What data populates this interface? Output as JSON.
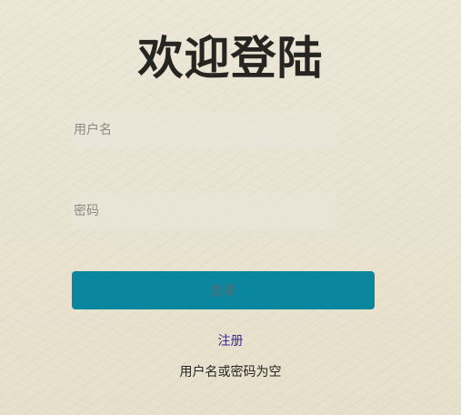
{
  "page": {
    "title": "欢迎登陆"
  },
  "form": {
    "username_placeholder": "用户名",
    "username_value": "",
    "password_placeholder": "密码",
    "password_value": "",
    "login_label": "登录",
    "register_label": "注册",
    "error_message": "用户名或密码为空"
  },
  "colors": {
    "accent": "#0a879f",
    "link": "#3b2c8a",
    "background": "#e8e2d0"
  }
}
